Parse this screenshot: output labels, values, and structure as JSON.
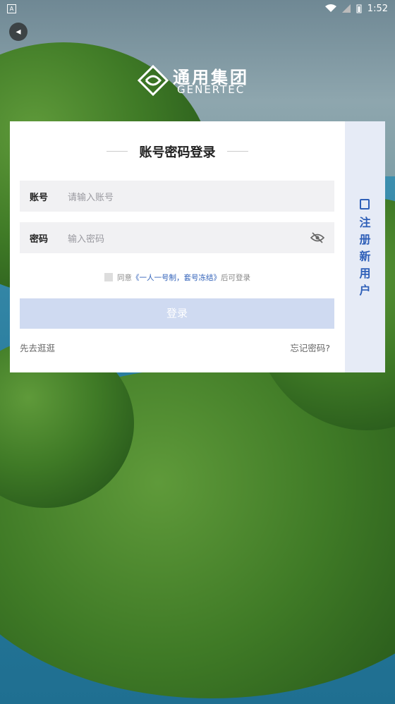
{
  "status": {
    "time": "1:52",
    "left_badge": "A"
  },
  "logo": {
    "cn": "通用集团",
    "en": "GENERTEC"
  },
  "form": {
    "title": "账号密码登录",
    "account_label": "账号",
    "account_placeholder": "请输入账号",
    "password_label": "密码",
    "password_placeholder": "输入密码",
    "agree_prefix": "同意",
    "agree_link": "《一人一号制，套号冻结》",
    "agree_suffix": "后可登录",
    "login_label": "登录",
    "guest_label": "先去逛逛",
    "forgot_label": "忘记密码?"
  },
  "side": {
    "register_label": "注\n册\n新\n用\n户"
  },
  "colors": {
    "accent": "#2e5fb8",
    "login_bg": "#cfdaf1",
    "side_bg": "#e6ebf6"
  }
}
